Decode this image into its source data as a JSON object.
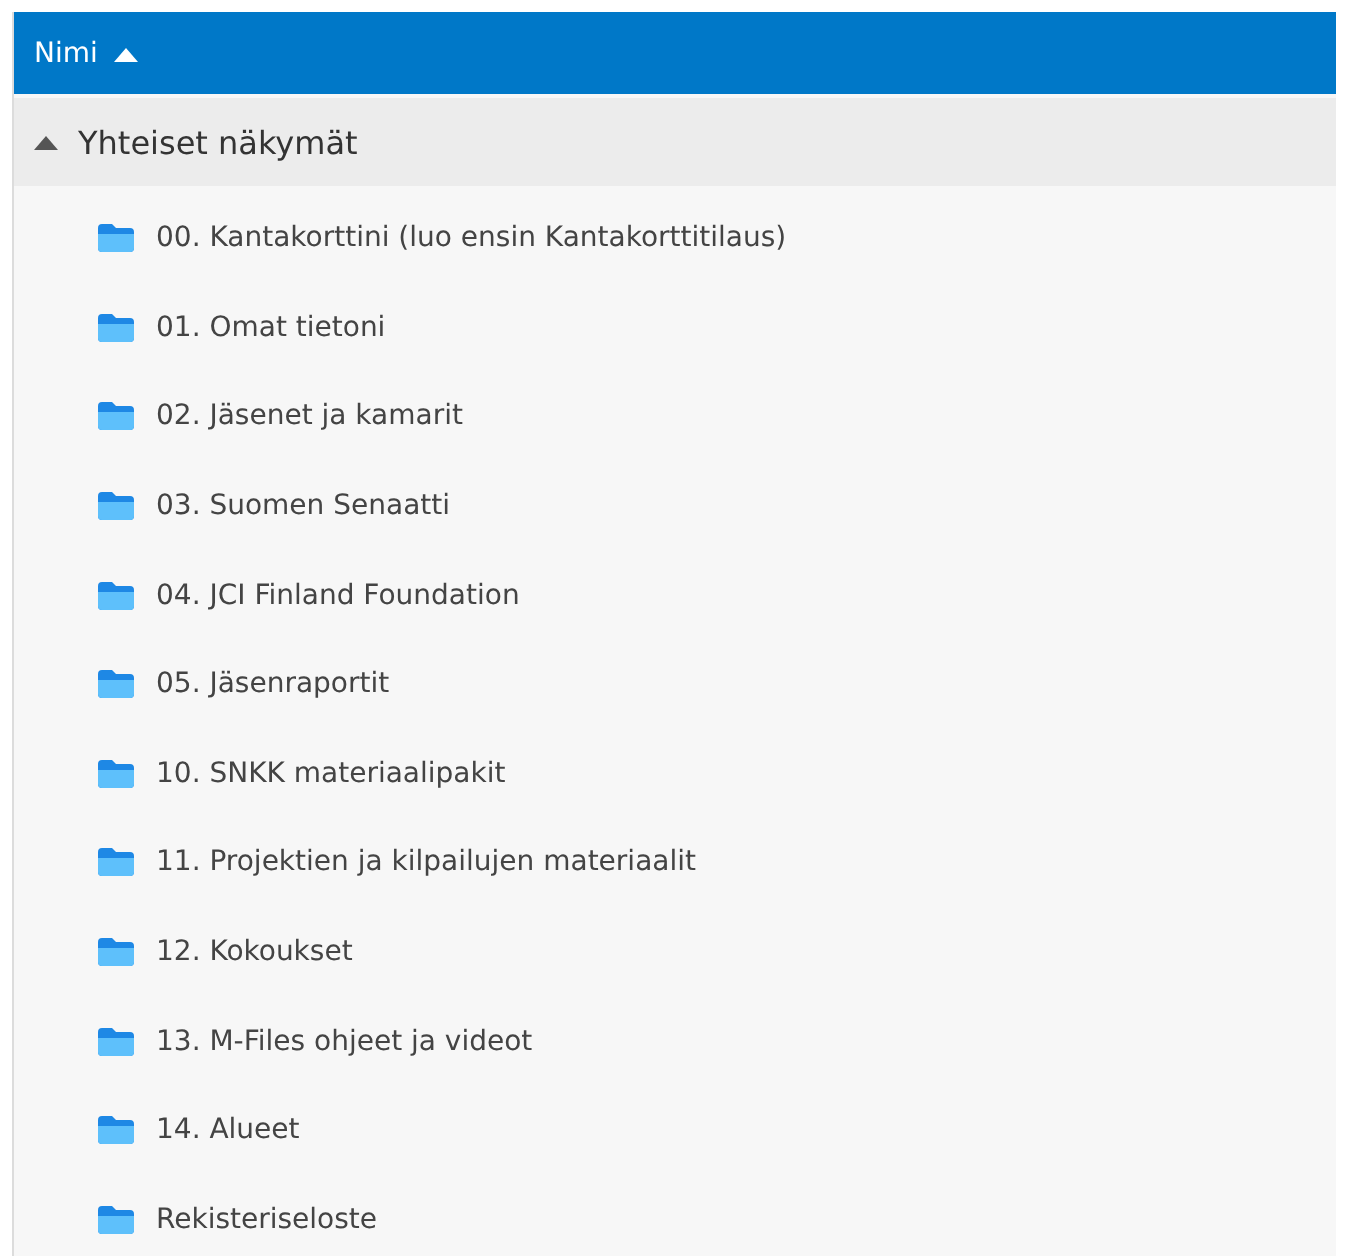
{
  "header": {
    "column": "Nimi",
    "ascending": true
  },
  "group": {
    "label": "Yhteiset näkymät",
    "expanded": true,
    "children": [
      {
        "label": "00. Kantakorttini (luo ensin Kantakorttitilaus)"
      },
      {
        "label": "01. Omat tietoni"
      },
      {
        "label": "02. Jäsenet ja kamarit"
      },
      {
        "label": "03. Suomen Senaatti"
      },
      {
        "label": "04. JCI Finland Foundation"
      },
      {
        "label": "05. Jäsenraportit"
      },
      {
        "label": "10. SNKK materiaalipakit"
      },
      {
        "label": "11. Projektien ja kilpailujen materiaalit"
      },
      {
        "label": "12. Kokoukset"
      },
      {
        "label": "13. M-Files ohjeet ja videot"
      },
      {
        "label": "14. Alueet"
      },
      {
        "label": "Rekisteriseloste"
      }
    ]
  }
}
